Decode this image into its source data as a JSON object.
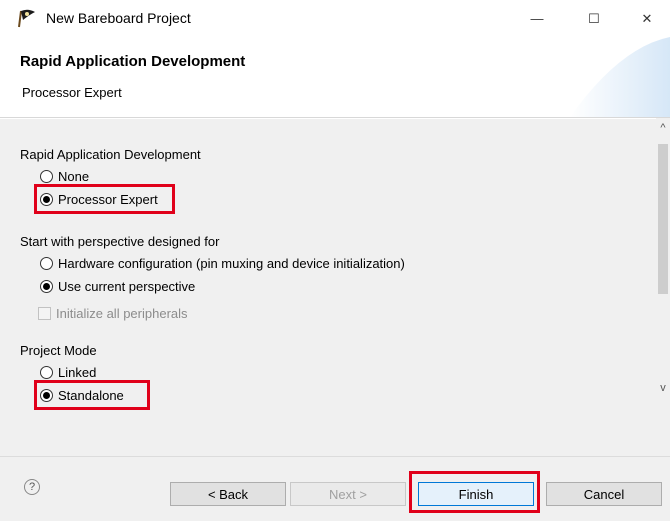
{
  "window": {
    "title": "New Bareboard Project",
    "controls": {
      "minimize": "—",
      "maximize": "☐",
      "close": "✕"
    }
  },
  "header": {
    "title": "Rapid Application Development",
    "description": "Processor Expert"
  },
  "sections": {
    "rad": {
      "label": "Rapid Application Development",
      "options": [
        "None",
        "Processor Expert"
      ],
      "selected": "Processor Expert"
    },
    "perspective": {
      "label": "Start with perspective designed for",
      "options": [
        "Hardware configuration (pin muxing and device initialization)",
        "Use current perspective"
      ],
      "selected": "Use current perspective"
    },
    "init_peripherals": {
      "label": "Initialize all peripherals",
      "checked": false,
      "enabled": false
    },
    "project_mode": {
      "label": "Project Mode",
      "options": [
        "Linked",
        "Standalone"
      ],
      "selected": "Standalone"
    }
  },
  "footer": {
    "help_icon": "?",
    "back": "< Back",
    "next": "Next >",
    "finish": "Finish",
    "cancel": "Cancel"
  },
  "scrollbar": {
    "up": "^",
    "down": "v"
  },
  "icons": {
    "app": "pirate-flag-icon",
    "help": "question-circle-icon"
  },
  "colors": {
    "highlight": "#e0001a",
    "primary_border": "#0078d7"
  }
}
